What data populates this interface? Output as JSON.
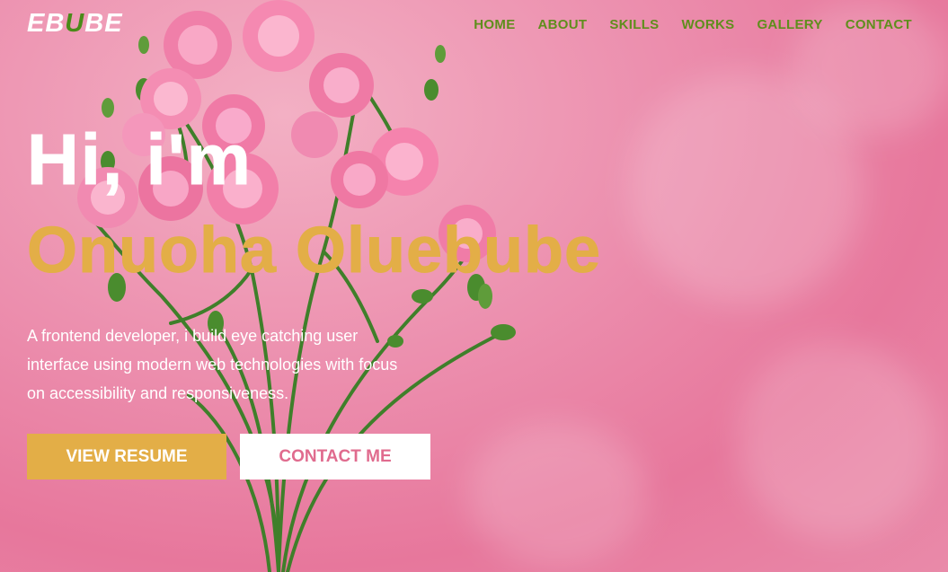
{
  "logo": {
    "part1": "EB",
    "accent": "U",
    "part2": "BE"
  },
  "nav": {
    "items": [
      "HOME",
      "ABOUT",
      "SKILLS",
      "WORKS",
      "GALLERY",
      "CONTACT"
    ]
  },
  "hero": {
    "greeting": "Hi, i'm",
    "name": "Onuoha Oluebube",
    "description": "A frontend developer, i build eye catching user interface using modern web technologies with focus on accessibility and responsiveness.",
    "primary_button": "VIEW RESUME",
    "secondary_button": "CONTACT ME"
  },
  "colors": {
    "accent_gold": "#e3ae47",
    "nav_green": "#5f8e1c",
    "contact_pink": "#e06b8e",
    "background_pink": "#ec8fae"
  },
  "background_image": "pink-roses-bouquet"
}
